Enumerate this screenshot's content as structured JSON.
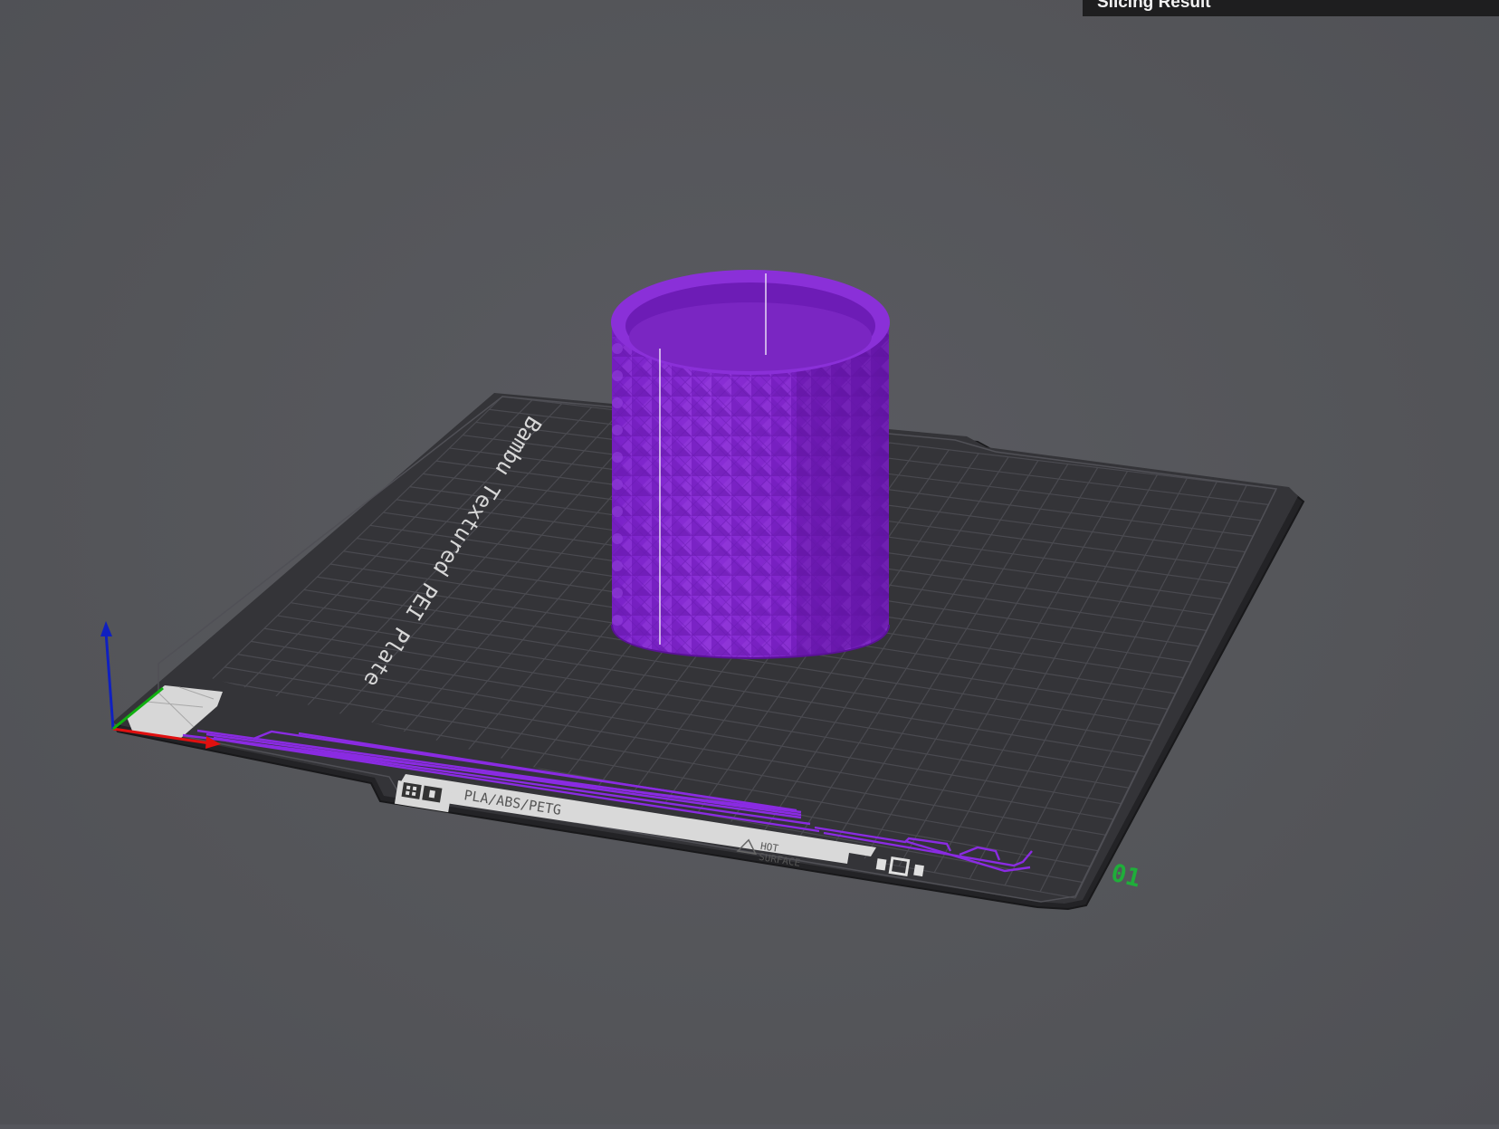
{
  "slicing_result_panel": {
    "title": "Slicing Result"
  },
  "build_plate": {
    "name_label": "Bambu Textured PEI Plate",
    "material_label": "PLA/ABS/PETG",
    "warning_label_line1": "HOT",
    "warning_label_line2": "SURFACE",
    "plate_number": "01"
  },
  "model": {
    "color": "#7d22c6"
  },
  "axes": {
    "x_color": "#e01010",
    "y_color": "#10b010",
    "z_color": "#1020c0"
  }
}
